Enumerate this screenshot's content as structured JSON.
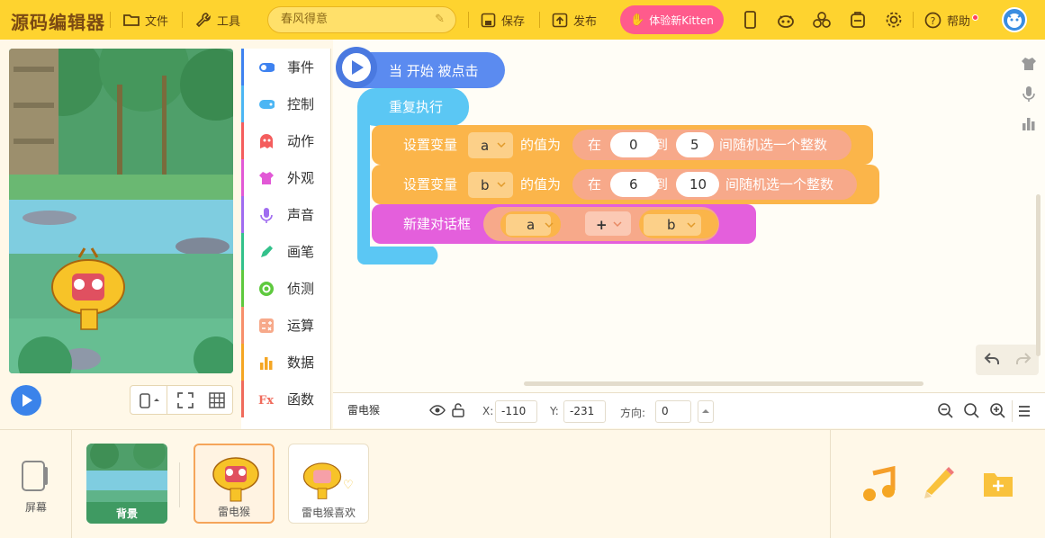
{
  "app": {
    "logo": "源码编辑器"
  },
  "toolbar": {
    "file_label": "文件",
    "tools_label": "工具",
    "project_title": "春风得意",
    "save_label": "保存",
    "publish_label": "发布",
    "kitten_label": "体验新Kitten",
    "help_label": "帮助"
  },
  "categories": [
    {
      "label": "事件",
      "color": "#3e82f0",
      "icon": "toggle-icon"
    },
    {
      "label": "控制",
      "color": "#4cb6f4",
      "icon": "gamepad-icon"
    },
    {
      "label": "动作",
      "color": "#f45d5d",
      "icon": "ghost-icon"
    },
    {
      "label": "外观",
      "color": "#e259d6",
      "icon": "shirt-icon"
    },
    {
      "label": "声音",
      "color": "#a06cf0",
      "icon": "mic-icon"
    },
    {
      "label": "画笔",
      "color": "#33c18b",
      "icon": "pen-icon"
    },
    {
      "label": "侦测",
      "color": "#5ec93e",
      "icon": "radar-icon"
    },
    {
      "label": "运算",
      "color": "#f78f6b",
      "icon": "calc-icon"
    },
    {
      "label": "数据",
      "color": "#f5a623",
      "icon": "bar-icon"
    },
    {
      "label": "函数",
      "color": "#f06b5c",
      "icon": "function-icon"
    }
  ],
  "blocks": {
    "hat": "当 开始 被点击",
    "loop": "重复执行",
    "set1": {
      "prefix": "设置变量",
      "var": "a",
      "mid": "的值为",
      "in": "在",
      "from": "0",
      "to_word": "到",
      "to": "5",
      "suffix": "间随机选一个整数"
    },
    "set2": {
      "prefix": "设置变量",
      "var": "b",
      "mid": "的值为",
      "in": "在",
      "from": "6",
      "to_word": "到",
      "to": "10",
      "suffix": "间随机选一个整数"
    },
    "dialog": {
      "label": "新建对话框",
      "left": "a",
      "op": "+",
      "right": "b"
    }
  },
  "status": {
    "sprite_name": "雷电猴",
    "x_label": "X:",
    "x_value": "-110",
    "y_label": "Y:",
    "y_value": "-231",
    "dir_label": "方向:",
    "dir_value": "0"
  },
  "sprites": {
    "screen_label": "屏幕",
    "items": [
      {
        "label": "背景"
      },
      {
        "label": "雷电猴"
      },
      {
        "label": "雷电猴喜欢"
      }
    ]
  },
  "colors": {
    "topbar": "#fed32f",
    "event_block": "#5b8bf0",
    "loop_block": "#5bc7f4",
    "data_block": "#fbb54a",
    "dialog_block": "#e45fdc",
    "kitten": "#ff5b8c"
  }
}
